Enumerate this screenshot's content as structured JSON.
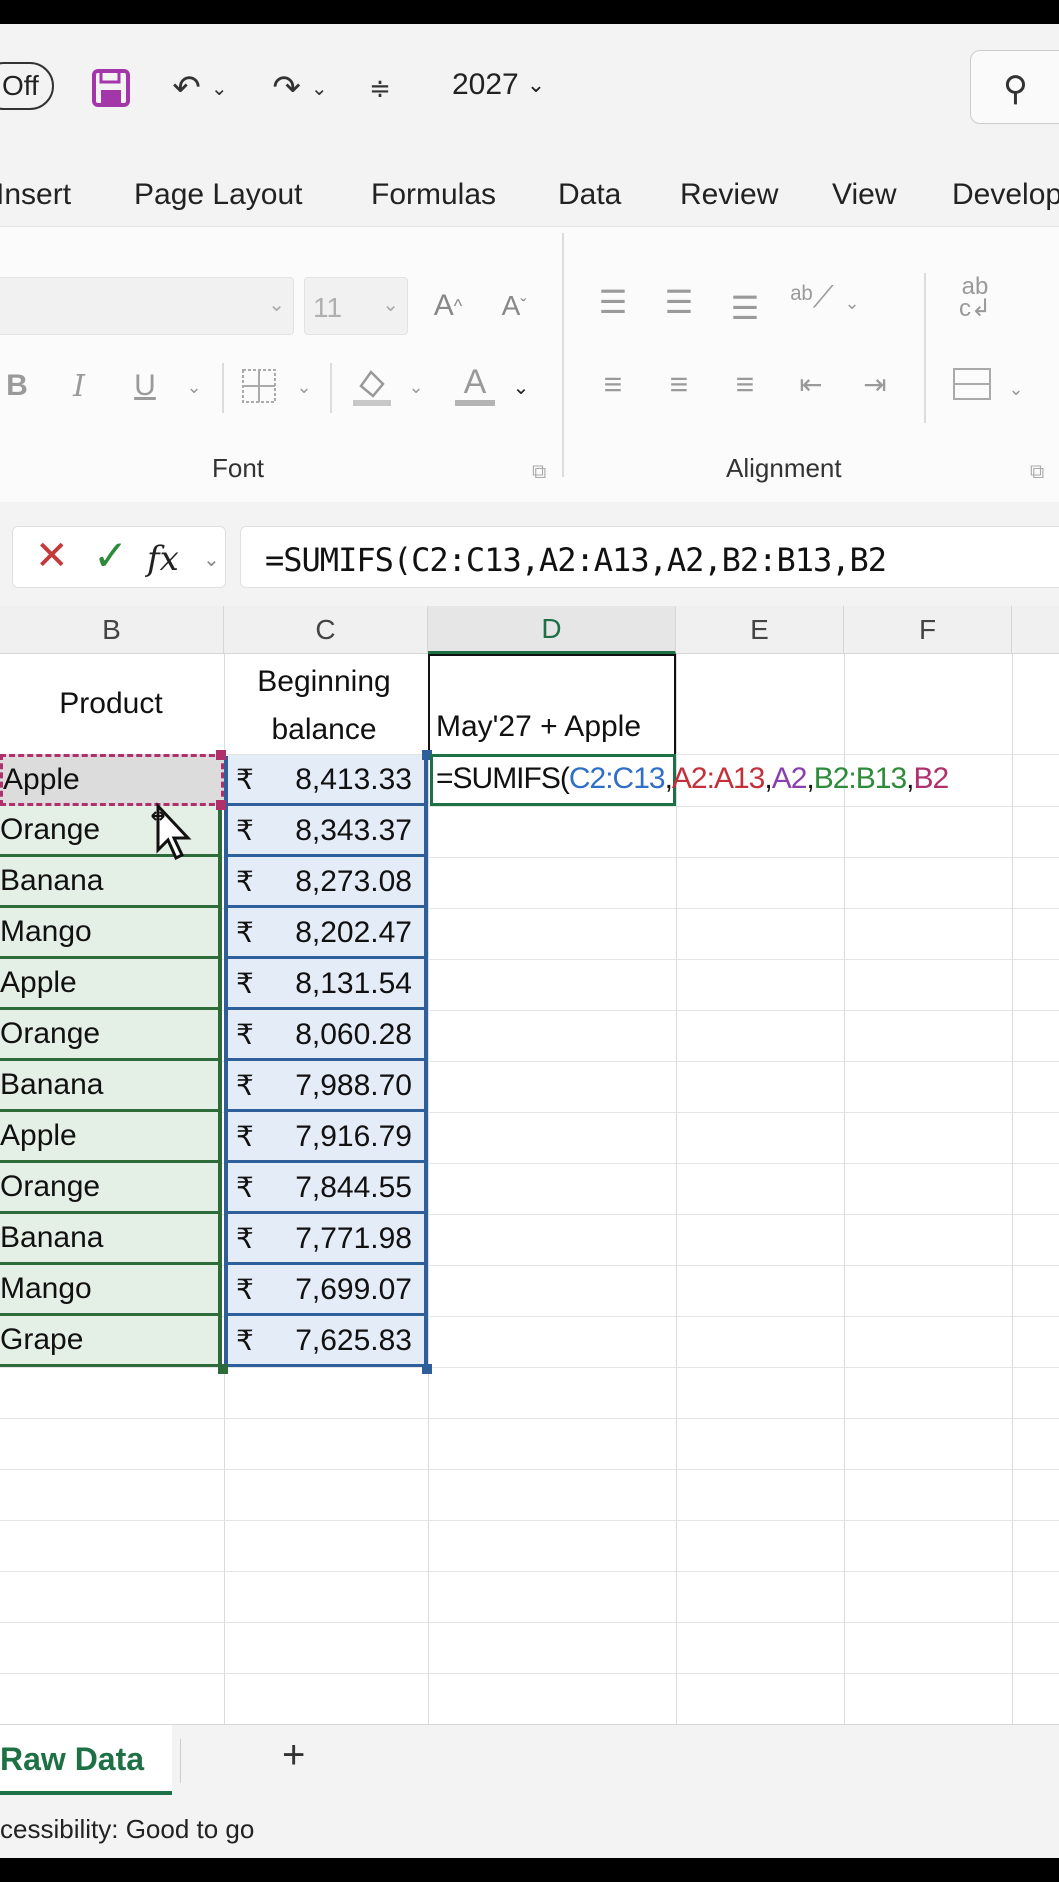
{
  "title_bar": {
    "autosave_state": "Off",
    "file_name": "2027",
    "icons": [
      "save-icon",
      "undo-icon",
      "redo-icon",
      "customize-icon",
      "search-icon"
    ]
  },
  "tabs": [
    "Insert",
    "Page Layout",
    "Formulas",
    "Data",
    "Review",
    "View",
    "Develop"
  ],
  "ribbon": {
    "font_size": "11",
    "font_group_label": "Font",
    "alignment_group_label": "Alignment",
    "bold": "B",
    "italic": "I",
    "underline": "U",
    "font_color": "A"
  },
  "formula_bar": {
    "fx": "fx",
    "formula": "=SUMIFS(C2:C13,A2:A13,A2,B2:B13,B2"
  },
  "grid": {
    "columns": [
      "B",
      "C",
      "D",
      "E",
      "F"
    ],
    "active_column": "D",
    "header_b": "Product",
    "header_c_line1": "Beginning",
    "header_c_line2": "balance",
    "header_d": "May'27 + Apple",
    "currency_symbol": "₹",
    "rows": [
      {
        "product": "Apple",
        "balance": "8,413.33"
      },
      {
        "product": "Orange",
        "balance": "8,343.37"
      },
      {
        "product": "Banana",
        "balance": "8,273.08"
      },
      {
        "product": "Mango",
        "balance": "8,202.47"
      },
      {
        "product": "Apple",
        "balance": "8,131.54"
      },
      {
        "product": "Orange",
        "balance": "8,060.28"
      },
      {
        "product": "Banana",
        "balance": "7,988.70"
      },
      {
        "product": "Apple",
        "balance": "7,916.79"
      },
      {
        "product": "Orange",
        "balance": "7,844.55"
      },
      {
        "product": "Banana",
        "balance": "7,771.98"
      },
      {
        "product": "Mango",
        "balance": "7,699.07"
      },
      {
        "product": "Grape",
        "balance": "7,625.83"
      }
    ],
    "editing_formula_parts": [
      {
        "text": "=SUMIFS(",
        "color": "#111111"
      },
      {
        "text": "C2:C13",
        "color": "#2f6fc7"
      },
      {
        "text": ",",
        "color": "#111111"
      },
      {
        "text": "A2:A13",
        "color": "#c4303a"
      },
      {
        "text": ",",
        "color": "#111111"
      },
      {
        "text": "A2",
        "color": "#8a3fb0"
      },
      {
        "text": ",",
        "color": "#111111"
      },
      {
        "text": "B2:B13",
        "color": "#2e8b3a"
      },
      {
        "text": ",",
        "color": "#111111"
      },
      {
        "text": "B2",
        "color": "#b0306b"
      }
    ]
  },
  "sheets": {
    "active": "Raw Data",
    "add_label": "+"
  },
  "status": {
    "text": "cessibility: Good to go"
  },
  "colors": {
    "accent_green": "#1e7145",
    "b_range": "#2e6b3a",
    "c_range": "#2f5f9a",
    "b2_ref": "#b0306b"
  }
}
